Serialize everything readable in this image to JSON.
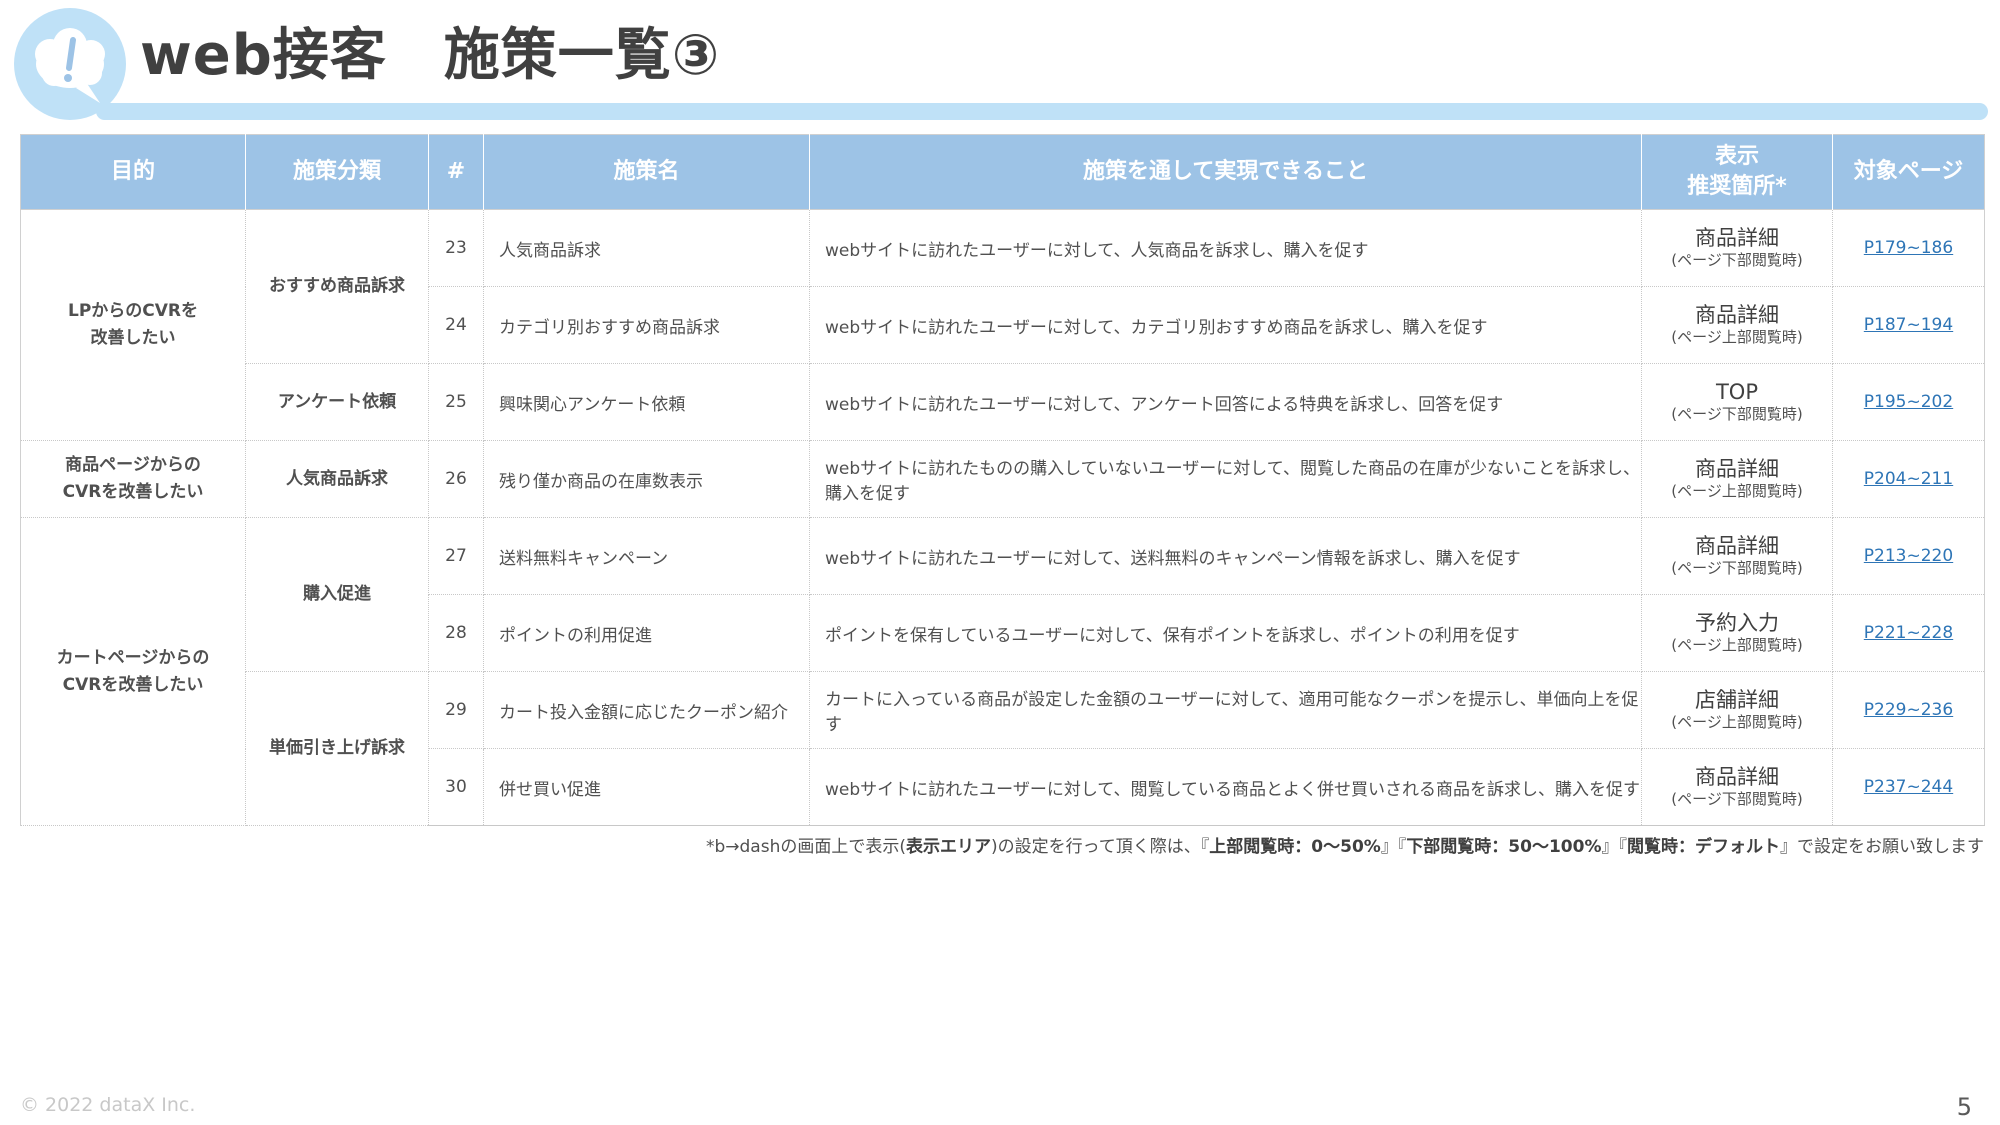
{
  "header": {
    "title": "web接客　施策一覧③"
  },
  "colors": {
    "header_fill": "#9dc3e6",
    "accent_light": "#bfe1f7",
    "link": "#2e75b6"
  },
  "icons": {
    "title_icon": "thought-bubble-exclamation-icon"
  },
  "table": {
    "headers": {
      "purpose": "目的",
      "category": "施策分類",
      "num": "#",
      "name": "施策名",
      "description": "施策を通して実現できること",
      "placement_line1": "表示",
      "placement_line2": "推奨箇所*",
      "target_page": "対象ページ"
    },
    "purposes": [
      {
        "line1": "LPからのCVRを",
        "line2": "改善したい"
      },
      {
        "line1": "商品ページからの",
        "line2": "CVRを改善したい"
      },
      {
        "line1": "カートページからの",
        "line2": "CVRを改善したい"
      }
    ],
    "categories": [
      "おすすめ商品訴求",
      "アンケート依頼",
      "人気商品訴求",
      "購入促進",
      "単価引き上げ訴求"
    ],
    "rows": [
      {
        "num": "23",
        "name": "人気商品訴求",
        "description": "webサイトに訪れたユーザーに対して、人気商品を訴求し、購入を促す",
        "place_main": "商品詳細",
        "place_sub": "(ページ下部閲覧時)",
        "page": "P179~186"
      },
      {
        "num": "24",
        "name": "カテゴリ別おすすめ商品訴求",
        "description": "webサイトに訪れたユーザーに対して、カテゴリ別おすすめ商品を訴求し、購入を促す",
        "place_main": "商品詳細",
        "place_sub": "(ページ上部閲覧時)",
        "page": "P187~194"
      },
      {
        "num": "25",
        "name": "興味関心アンケート依頼",
        "description": "webサイトに訪れたユーザーに対して、アンケート回答による特典を訴求し、回答を促す",
        "place_main": "TOP",
        "place_sub": "(ページ下部閲覧時)",
        "page": "P195~202"
      },
      {
        "num": "26",
        "name": "残り僅か商品の在庫数表示",
        "description": "webサイトに訪れたものの購入していないユーザーに対して、閲覧した商品の在庫が少ないことを訴求し、購入を促す",
        "place_main": "商品詳細",
        "place_sub": "(ページ上部閲覧時)",
        "page": "P204~211"
      },
      {
        "num": "27",
        "name": "送料無料キャンペーン",
        "description": "webサイトに訪れたユーザーに対して、送料無料のキャンペーン情報を訴求し、購入を促す",
        "place_main": "商品詳細",
        "place_sub": "(ページ下部閲覧時)",
        "page": "P213~220"
      },
      {
        "num": "28",
        "name": "ポイントの利用促進",
        "description": "ポイントを保有しているユーザーに対して、保有ポイントを訴求し、ポイントの利用を促す",
        "place_main": "予約入力",
        "place_sub": "(ページ上部閲覧時)",
        "page": "P221~228"
      },
      {
        "num": "29",
        "name": "カート投入金額に応じたクーポン紹介",
        "description": "カートに入っている商品が設定した金額のユーザーに対して、適用可能なクーポンを提示し、単価向上を促す",
        "place_main": "店舗詳細",
        "place_sub": "(ページ上部閲覧時)",
        "page": "P229~236"
      },
      {
        "num": "30",
        "name": "併せ買い促進",
        "description": "webサイトに訪れたユーザーに対して、閲覧している商品とよく併せ買いされる商品を訴求し、購入を促す",
        "place_main": "商品詳細",
        "place_sub": "(ページ下部閲覧時)",
        "page": "P237~244"
      }
    ]
  },
  "footnote": {
    "part1": "*b→dashの画面上で表示(",
    "bold1": "表示エリア",
    "part2": ")の設定を行って頂く際は、『",
    "bold2": "上部閲覧時：0～50%",
    "part3": "』『",
    "bold3": "下部閲覧時：50～100%",
    "part4": "』『",
    "bold4": "閲覧時：デフォルト",
    "part5": "』で設定をお願い致します"
  },
  "footer": {
    "copyright": "© 2022 dataX Inc.",
    "page_number": "5"
  }
}
